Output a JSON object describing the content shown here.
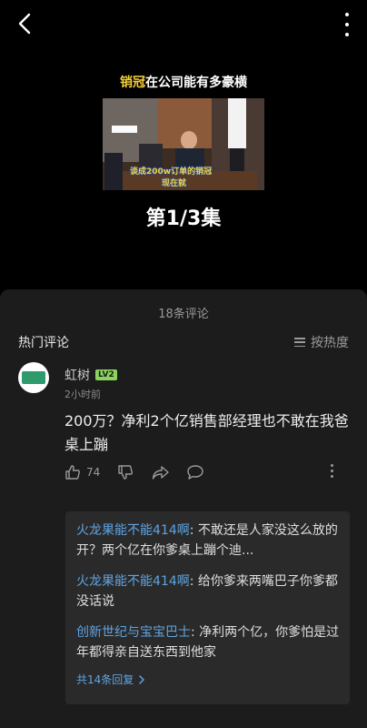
{
  "video": {
    "title_highlight": "销冠",
    "title_rest": "在公司能有多豪横",
    "thumbnail_caption_1": "谈成200w订单的销冠",
    "thumbnail_caption_2": "现在就",
    "episode": "第1/3集"
  },
  "comments": {
    "count_label": "18条评论",
    "hot_label": "热门评论",
    "sort_label": "按热度",
    "top_comment": {
      "username": "虹树",
      "level": "LV2",
      "time": "2小时前",
      "text": "200万？净利2个亿销售部经理也不敢在我爸桌上蹦",
      "likes": "74"
    },
    "replies": [
      {
        "name": "火龙果能不能414啊",
        "text": ": 不敢还是人家没这么放的开？两个亿在你爹桌上蹦个迪..."
      },
      {
        "name": "火龙果能不能414啊",
        "text": ": 给你爹来两嘴巴子你爹都没话说"
      },
      {
        "name": "创新世纪与宝宝巴士",
        "text": ": 净利两个亿，你爹怕是过年都得亲自送东西到他家"
      }
    ],
    "more_replies_label": "共14条回复"
  }
}
